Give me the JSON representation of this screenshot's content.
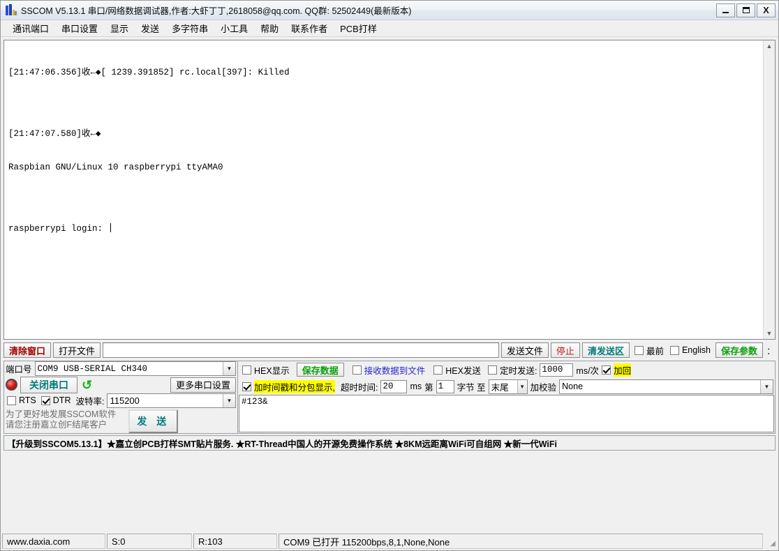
{
  "window": {
    "title": "SSCOM V5.13.1 串口/网络数据调试器,作者:大虾丁丁,2618058@qq.com. QQ群: 52502449(最新版本)",
    "minimize_label": "_",
    "maximize_label": "□",
    "close_label": "X"
  },
  "menu": {
    "items": [
      {
        "label": "通讯端口"
      },
      {
        "label": "串口设置"
      },
      {
        "label": "显示"
      },
      {
        "label": "发送"
      },
      {
        "label": "多字符串"
      },
      {
        "label": "小工具"
      },
      {
        "label": "帮助"
      },
      {
        "label": "联系作者"
      },
      {
        "label": "PCB打样"
      }
    ]
  },
  "receive": {
    "lines": [
      "[21:47:06.356]收←◆[ 1239.391852] rc.local[397]: Killed",
      "",
      "[21:47:07.580]收←◆",
      "Raspbian GNU/Linux 10 raspberrypi ttyAMA0",
      "",
      "raspberrypi login: "
    ],
    "scroll_up_glyph": "▲",
    "scroll_down_glyph": "▼"
  },
  "toolbar": {
    "clear_window": "清除窗口",
    "open_file": "打开文件",
    "file_path": "",
    "send_file": "发送文件",
    "stop": "停止",
    "clear_send": "清发送区",
    "topmost_label": "最前",
    "topmost_checked": false,
    "english_label": "English",
    "english_checked": false,
    "save_params": "保存参数",
    "more_dots": "："
  },
  "settings": {
    "port_label": "端口号",
    "port_value": "COM9 USB-SERIAL CH340",
    "close_port_button": "关闭串口",
    "more_port_settings": "更多串口设置",
    "rts_label": "RTS",
    "rts_checked": false,
    "dtr_label": "DTR",
    "dtr_checked": true,
    "baud_label": "波特率:",
    "baud_value": "115200",
    "notice_line1": "为了更好地发展SSCOM软件",
    "notice_line2": "请您注册嘉立创F结尾客户",
    "send_button": "发 送",
    "hex_display_label": "HEX显示",
    "hex_display_checked": false,
    "save_data_button": "保存数据",
    "recv_to_file_label": "接收数据到文件",
    "recv_to_file_checked": false,
    "hex_send_label": "HEX发送",
    "hex_send_checked": false,
    "timed_send_label": "定时发送:",
    "timed_send_checked": false,
    "timed_send_value": "1000",
    "ms_per_label": "ms/次",
    "add_newline_label": "加回",
    "add_newline_checked": true,
    "timestamp_label": "加时间戳和分包显示,",
    "timestamp_checked": true,
    "timeout_label": "超时时间:",
    "timeout_value": "20",
    "ms_label": "ms",
    "byte_prefix": "第",
    "byte_index": "1",
    "byte_label": "字节 至",
    "byte_end": "末尾",
    "checksum_label": "加校验",
    "checksum_value": "None",
    "send_text": "#123&"
  },
  "adbar": {
    "text": "【升级到SSCOM5.13.1】★嘉立创PCB打样SMT贴片服务. ★RT-Thread中国人的开源免费操作系统 ★8KM远距离WiFi可自组网 ★新一代WiFi"
  },
  "statusbar": {
    "website": "www.daxia.com",
    "sent": "S:0",
    "received": "R:103",
    "connection": "COM9 已打开  115200bps,8,1,None,None",
    "grip": "◢"
  },
  "colors": {
    "accent_red": "#a00000",
    "accent_teal": "#007a7a",
    "accent_green": "#0aa00a",
    "accent_blue": "#2222cc",
    "highlight_yellow": "#ffff00"
  }
}
